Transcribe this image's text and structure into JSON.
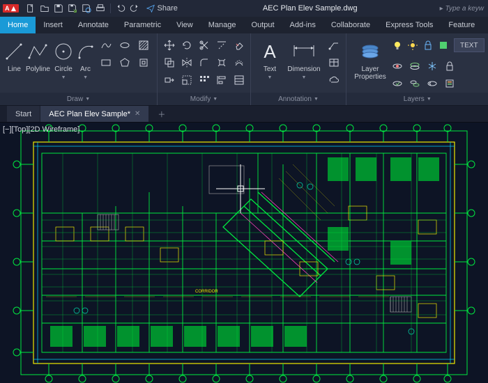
{
  "app": {
    "badge": "CAD",
    "title": "AEC Plan Elev Sample.dwg",
    "search_placeholder": "Type a keyw",
    "share": "Share"
  },
  "menu": {
    "tabs": [
      "Home",
      "Insert",
      "Annotate",
      "Parametric",
      "View",
      "Manage",
      "Output",
      "Add-ins",
      "Collaborate",
      "Express Tools",
      "Feature"
    ],
    "active": 0
  },
  "ribbon": {
    "draw": {
      "title": "Draw",
      "line": "Line",
      "polyline": "Polyline",
      "circle": "Circle",
      "arc": "Arc"
    },
    "modify": {
      "title": "Modify"
    },
    "annotation": {
      "title": "Annotation",
      "text": "Text",
      "dimension": "Dimension"
    },
    "layers": {
      "title": "Layers",
      "props": "Layer\nProperties",
      "textbtn": "TEXT"
    }
  },
  "doctabs": {
    "tabs": [
      {
        "label": "Start"
      },
      {
        "label": "AEC Plan Elev Sample*",
        "close": true
      }
    ],
    "active": 1
  },
  "canvas": {
    "viewlabel": "[−][Top][2D Wireframe]"
  }
}
